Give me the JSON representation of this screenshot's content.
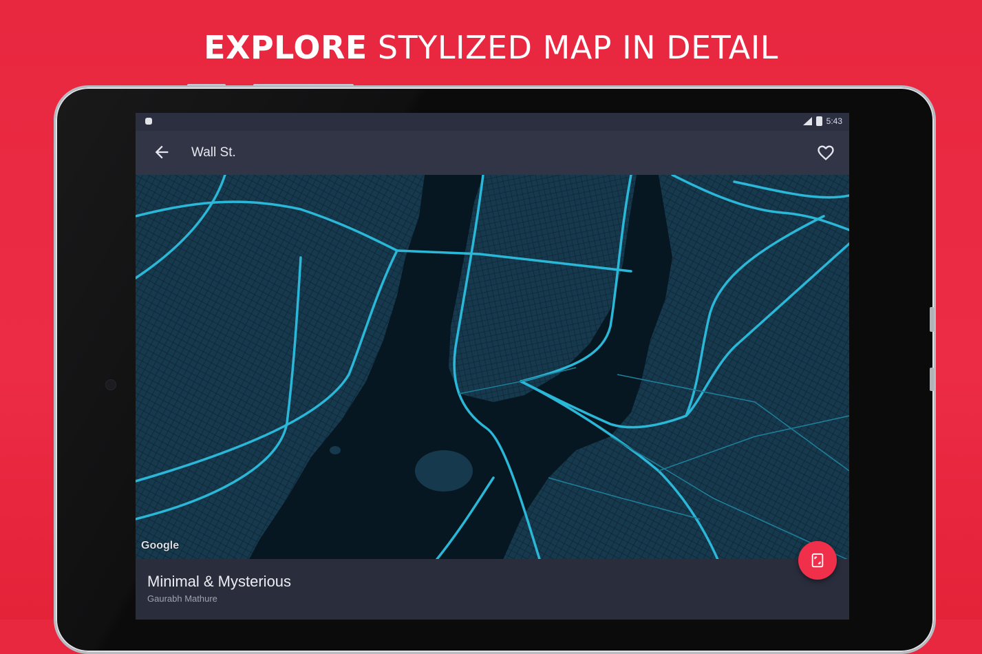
{
  "headline": {
    "bold": "EXPLORE",
    "rest": " STYLIZED MAP IN DETAIL"
  },
  "status_bar": {
    "time": "5:43"
  },
  "app_bar": {
    "title": "Wall St."
  },
  "map": {
    "attribution": "Google"
  },
  "info": {
    "style_name": "Minimal & Mysterious",
    "author": "Gaurabh Mathure"
  },
  "colors": {
    "background": "#ec2b45",
    "accent": "#f0304a",
    "road": "#2bb8d8",
    "land": "#17394d",
    "water": "#071722",
    "toolbar": "#323546"
  },
  "icons": {
    "back": "arrow-left-icon",
    "favorite": "heart-outline-icon",
    "set_wallpaper": "wallpaper-icon"
  }
}
